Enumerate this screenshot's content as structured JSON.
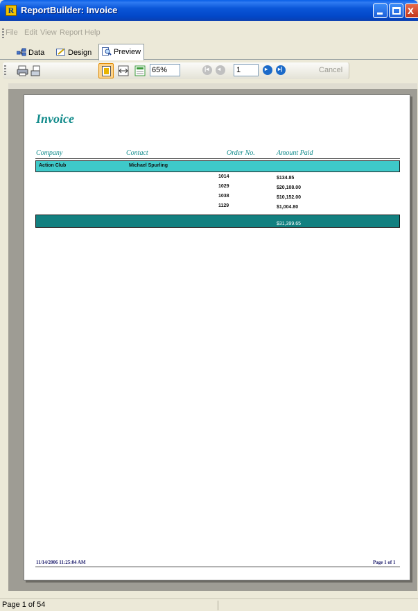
{
  "window": {
    "title": "ReportBuilder: Invoice",
    "app_icon_letter": "R",
    "controls": {
      "minimize": "minimize",
      "maximize": "maximize",
      "close": "x"
    }
  },
  "menu": [
    "File",
    "Edit",
    "View",
    "Report",
    "Help"
  ],
  "tabs": [
    {
      "label": "Data",
      "icon": "data-icon",
      "active": false
    },
    {
      "label": "Design",
      "icon": "design-icon",
      "active": false
    },
    {
      "label": "Preview",
      "icon": "preview-icon",
      "active": true
    }
  ],
  "toolbar": {
    "zoom": "65%",
    "page_number": "1",
    "cancel_label": "Cancel"
  },
  "report": {
    "title": "Invoice",
    "columns": [
      "Company",
      "Contact",
      "Order No.",
      "Amount Paid"
    ],
    "group": {
      "company": "Action Club",
      "contact": "Michael Spurling"
    },
    "rows": [
      {
        "order_no": "1014",
        "amount": "$134.85"
      },
      {
        "order_no": "1029",
        "amount": "$20,108.00"
      },
      {
        "order_no": "1038",
        "amount": "$10,152.00"
      },
      {
        "order_no": "1129",
        "amount": "$1,004.80"
      }
    ],
    "total": "$31,399.65",
    "footer_date": "11/14/2006 11:25:04 AM",
    "footer_page": "Page 1 of 1"
  },
  "status": {
    "text": "Page 1 of 54"
  },
  "colors": {
    "accent": "#108a8a",
    "group_band": "#3ec9c9",
    "total_band": "#128080"
  }
}
